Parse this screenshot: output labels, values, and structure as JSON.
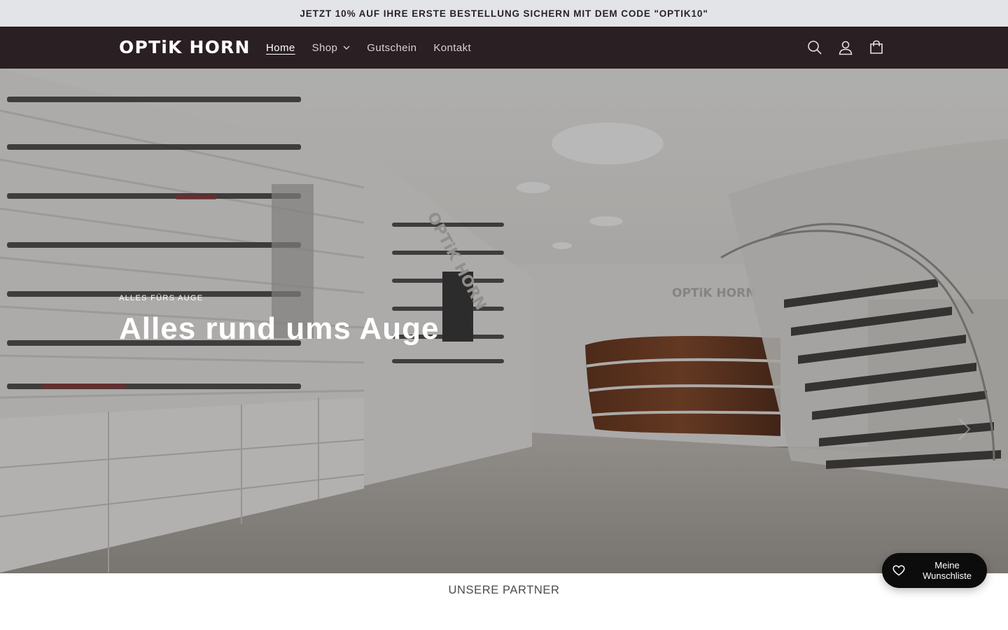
{
  "announcement": {
    "text": "JETZT 10% AUF IHRE ERSTE BESTELLUNG SICHERN MIT DEM CODE \"OPTIK10\""
  },
  "header": {
    "logo": "OPTiK HORN",
    "nav": [
      {
        "label": "Home",
        "active": true
      },
      {
        "label": "Shop",
        "has_dropdown": true
      },
      {
        "label": "Gutschein"
      },
      {
        "label": "Kontakt"
      }
    ],
    "icons": [
      "search-icon",
      "account-icon",
      "cart-icon"
    ]
  },
  "hero": {
    "subheading": "ALLES FÜRS AUGE",
    "heading": "Alles rund ums Auge",
    "shop_sign_main": "OPTiK HORN",
    "shop_sign_back": "OPTiK HORN"
  },
  "partners": {
    "heading": "UNSERE PARTNER"
  },
  "wishlist": {
    "label": "Meine Wunschliste",
    "icon": "heart-icon"
  },
  "colors": {
    "header_bg": "#2a1f22",
    "announcement_bg": "#e2e4e8",
    "wishlist_bg": "#0c0c0c"
  }
}
